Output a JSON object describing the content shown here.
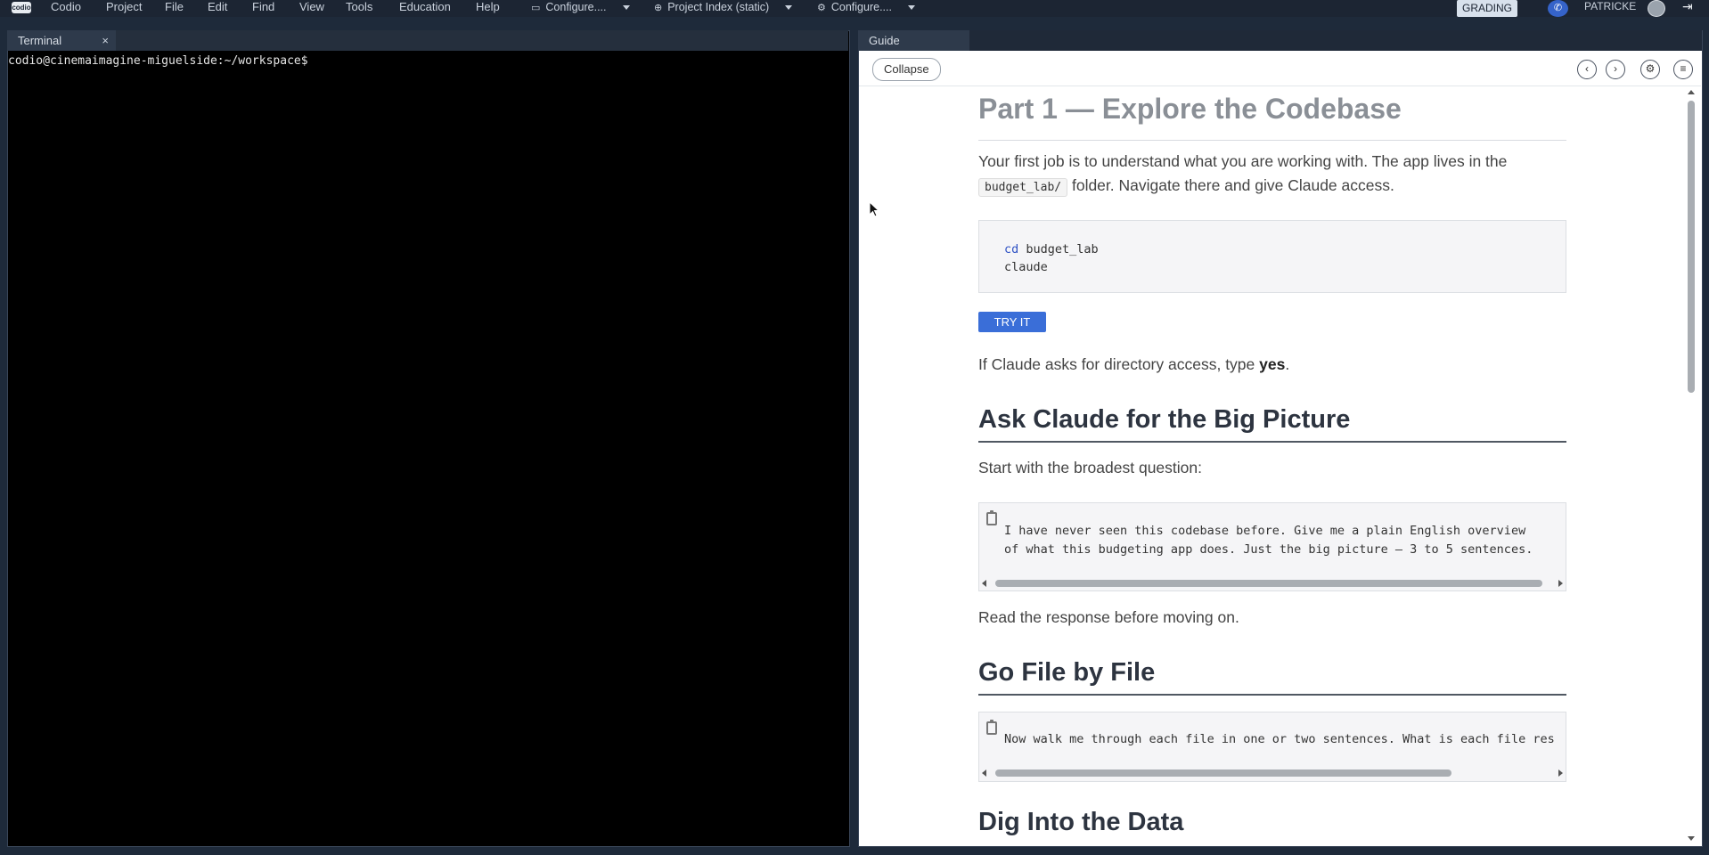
{
  "menubar": {
    "logo": "codio",
    "items": [
      "Codio",
      "Project",
      "File",
      "Edit",
      "Find",
      "View",
      "Tools",
      "Education",
      "Help"
    ],
    "configure1": "Configure....",
    "project_index": "Project Index (static)",
    "configure2": "Configure....",
    "grading": "GRADING",
    "user": "PATRICKE"
  },
  "terminal": {
    "tab_label": "Terminal",
    "prompt": "codio@cinemaimagine-miguelside:~/workspace$"
  },
  "guide": {
    "tab_label": "Guide",
    "collapse_label": "Collapse",
    "title": "Part 1 — Explore the Codebase",
    "intro_a": "Your first job is to understand what you are working with. The app lives in the",
    "intro_code": "budget_lab/",
    "intro_b": "folder. Navigate there and give Claude access.",
    "code1_kw": "cd",
    "code1_arg": " budget_lab",
    "code1_line2": "claude",
    "try_label": "TRY IT",
    "access_a": "If Claude asks for directory access, type ",
    "access_bold": "yes",
    "access_end": ".",
    "h_big_picture": "Ask Claude for the Big Picture",
    "start_text": "Start with the broadest question:",
    "prompt1_line1": "I have never seen this codebase before. Give me a plain English overview",
    "prompt1_line2": "of what this budgeting app does. Just the big picture — 3 to 5 sentences.",
    "read_text": "Read the response before moving on.",
    "h_file_by_file": "Go File by File",
    "prompt2_line1": "Now walk me through each file in one or two sentences. What is each file res",
    "h_dig": "Dig Into the Data"
  },
  "colors": {
    "menubar_bg": "#1c2533",
    "accent_button": "#3a6ed8",
    "terminal_bg": "#000000"
  }
}
